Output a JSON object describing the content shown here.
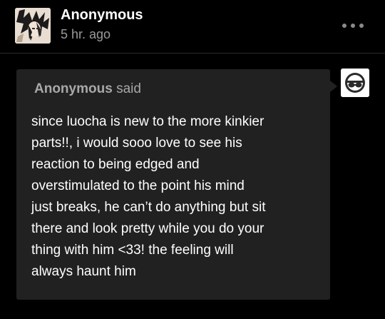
{
  "post": {
    "author": "Anonymous",
    "timestamp": "5 hr. ago",
    "more_icon": "ellipsis-icon"
  },
  "ask": {
    "asker": "Anonymous",
    "said": "said",
    "lines": [
      "since luocha is new to the more kinkier",
      "parts!!, i would sooo love to see his",
      "reaction to being edged and",
      "overstimulated to the point his mind",
      "just breaks, he can’t do anything but sit",
      "there and look pretty while you do your",
      "thing with him <33! the feeling will",
      "always haunt him"
    ],
    "asker_avatar_icon": "anonymous-mask-icon"
  },
  "colors": {
    "background": "#000000",
    "bubble": "#212121",
    "text": "#ffffff",
    "muted": "#9a9a9a"
  }
}
